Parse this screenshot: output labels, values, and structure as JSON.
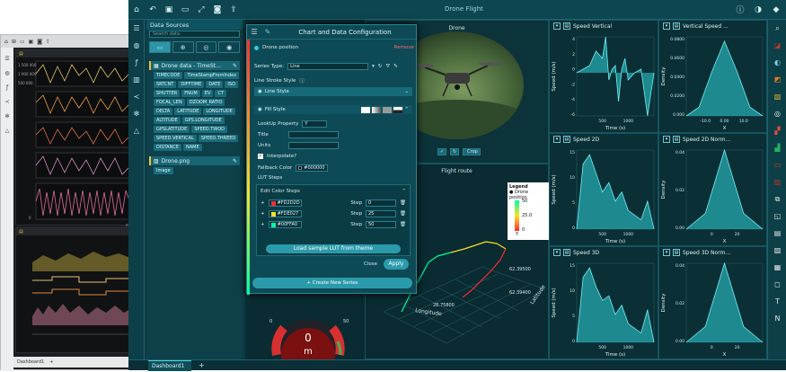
{
  "background_window": {
    "menu_items": [
      "⌂",
      "☰",
      "☁",
      "✂",
      "⚙",
      "⭐"
    ],
    "tab": "Dashboard1",
    "plus": "+",
    "label_m": "m",
    "ticks": [
      "1 500 000",
      "1 000 000",
      "500 000",
      "0"
    ]
  },
  "app": {
    "title": "Drone Flight",
    "status_tab": "Dashboard1",
    "status_plus": "+"
  },
  "data_sources": {
    "title": "Data Sources",
    "search_placeholder": "Search data",
    "source1": "Drone data - TimeSt...",
    "chips": [
      "TIMECODE",
      "TimeStampFromIndex",
      "SRTCNT",
      "DIFFTIME",
      "DATE",
      "ISO",
      "SHUTTER",
      "FNUM",
      "EV",
      "CT",
      "FOCAL_LEN",
      "DZOOM_RATIO",
      "DELTA",
      "LATITUDE",
      "LONGITUDE",
      "ALTITUDE",
      "GPS.LONGITUDE",
      "GPSLATITUDE",
      "SPEED.TWOD",
      "SPEED.VERTICAL",
      "SPEED.THREED",
      "DISTANCE",
      "NAME"
    ],
    "source2": "Drone.png",
    "chips2": [
      "Image"
    ]
  },
  "modal": {
    "title": "Chart and Data Configuration",
    "series_name": "Drone position",
    "remove": "Remove",
    "series_type_label": "Series Type:",
    "series_type_value": "Line",
    "line_stroke_label": "Line Stroke Style",
    "line_style": "Line Style",
    "fill_style": "Fill Style",
    "lookup_label": "LookUp Property",
    "lookup_value": "Y",
    "title_label": "Title",
    "units_label": "Units",
    "interpolate_label": "Interpolate?",
    "fallback_label": "Fallback Color",
    "fallback_value": "#000000",
    "lut_steps": "LUT Steps",
    "edit_color_steps": "Edit Color Steps",
    "steps": [
      {
        "color": "#FD2D2D",
        "label": "#FD2D2D",
        "step_label": "Step",
        "value": "0"
      },
      {
        "color": "#FDE027",
        "label": "#FDE027",
        "step_label": "Step",
        "value": "25"
      },
      {
        "color": "#00FFA0",
        "label": "#00FFA0",
        "step_label": "Step",
        "value": "50"
      }
    ],
    "load_lut": "Load sample LUT from theme",
    "close": "Close",
    "apply": "Apply",
    "create_series": "+ Create New Series"
  },
  "video": {
    "title": "Drone",
    "crop": "Crop"
  },
  "flight": {
    "title": "Flight route",
    "legend_title": "Legend",
    "legend_item": "Drone position",
    "legend_ticks": [
      "50",
      "25.0",
      "0"
    ],
    "legend_axis": "Y",
    "axis_longitude": "Longitude",
    "axis_latitude": "Latitude",
    "tick_lon": "28.75800",
    "tick_lat1": "62.39500",
    "tick_lat2": "62.39400"
  },
  "gauge": {
    "value": "0",
    "unit": "m",
    "min": "0",
    "max": "50"
  },
  "panels": [
    {
      "title": "Speed Vertical",
      "ylabel": "Speed (m/s)",
      "xlabel": "Time (s)",
      "yticks": [
        "4",
        "2",
        "0",
        "-2",
        "-4",
        "-6"
      ],
      "xticks": [
        "500",
        "1000"
      ]
    },
    {
      "title": "Vertical Speed ...",
      "ylabel": "Density",
      "xlabel": "X",
      "yticks": [
        "0.0800",
        "0.0600",
        "0.0400",
        "0.0200",
        "0.000"
      ],
      "xticks": [
        "-10.0",
        "0.00",
        "10.0"
      ]
    },
    {
      "title": "Speed 2D",
      "ylabel": "Speed (m/s)",
      "xlabel": "Time (s)",
      "yticks": [
        "15",
        "10",
        "5",
        "0"
      ],
      "xticks": [
        "500",
        "1000"
      ]
    },
    {
      "title": "Speed 2D Norm...",
      "ylabel": "Density",
      "xlabel": "X",
      "yticks": [
        "0.04",
        "0.02",
        "0.00"
      ],
      "xticks": [
        "0",
        "20"
      ]
    },
    {
      "title": "Speed 3D",
      "ylabel": "Speed (m/s)",
      "xlabel": "Time (s)",
      "yticks": [
        "15",
        "10",
        "5",
        "0"
      ],
      "xticks": [
        "500",
        "1000"
      ]
    },
    {
      "title": "Speed 3D Norm...",
      "ylabel": "Density",
      "xlabel": "X",
      "yticks": [
        "0.04",
        "0.02",
        "0.00"
      ],
      "xticks": [
        "0",
        "20"
      ]
    }
  ],
  "icons": {
    "rail_colors": [
      "#e0e0e0",
      "#c0392b",
      "#7bd4e0",
      "#e67e22",
      "#e0b030",
      "#ecf0f1",
      "#e74c3c",
      "#27ae60",
      "#d35400",
      "#c0392b",
      "#e6e6e6",
      "#e6e6e6",
      "#e6e6e6",
      "#e6e6e6",
      "#e6e6e6",
      "#e6e6e6",
      "#e6e6e6",
      "#e6e6e6"
    ]
  },
  "chart_data": [
    {
      "type": "area",
      "title": "Speed Vertical",
      "xlabel": "Time (s)",
      "ylabel": "Speed (m/s)",
      "x": [
        0,
        100,
        200,
        300,
        400,
        450,
        500,
        550,
        600,
        650,
        700,
        750,
        800,
        900,
        1000,
        1100,
        1200
      ],
      "y": [
        0,
        0.5,
        1,
        3,
        2,
        5,
        -1,
        0.5,
        1,
        -4,
        0.5,
        2,
        -1,
        0,
        0.5,
        -6,
        0
      ],
      "ylim": [
        -6,
        5
      ]
    },
    {
      "type": "area",
      "title": "Vertical Speed ...",
      "xlabel": "X",
      "ylabel": "Density",
      "x": [
        -15,
        -10,
        -5,
        0,
        5,
        10,
        15
      ],
      "y": [
        0,
        0.01,
        0.05,
        0.085,
        0.05,
        0.01,
        0
      ],
      "ylim": [
        0,
        0.09
      ]
    },
    {
      "type": "area",
      "title": "Speed 2D",
      "xlabel": "Time (s)",
      "ylabel": "Speed (m/s)",
      "x": [
        0,
        100,
        200,
        300,
        400,
        500,
        600,
        700,
        800,
        900,
        1000,
        1100,
        1200
      ],
      "y": [
        0,
        14,
        16,
        12,
        8,
        10,
        6,
        8,
        4,
        3,
        2,
        6,
        0
      ],
      "ylim": [
        0,
        17
      ]
    },
    {
      "type": "area",
      "title": "Speed 2D Norm...",
      "xlabel": "X",
      "ylabel": "Density",
      "x": [
        -10,
        0,
        5,
        10,
        15,
        20,
        30
      ],
      "y": [
        0,
        0.01,
        0.03,
        0.05,
        0.03,
        0.01,
        0
      ],
      "ylim": [
        0,
        0.05
      ]
    },
    {
      "type": "area",
      "title": "Speed 3D",
      "xlabel": "Time (s)",
      "ylabel": "Speed (m/s)",
      "x": [
        0,
        100,
        200,
        300,
        400,
        500,
        600,
        700,
        800,
        900,
        1000,
        1100,
        1200
      ],
      "y": [
        0,
        14,
        16,
        12,
        9,
        10,
        6,
        8,
        4,
        3,
        2,
        7,
        0
      ],
      "ylim": [
        0,
        17
      ]
    },
    {
      "type": "area",
      "title": "Speed 3D Norm...",
      "xlabel": "X",
      "ylabel": "Density",
      "x": [
        -10,
        0,
        5,
        10,
        15,
        20,
        30
      ],
      "y": [
        0,
        0.01,
        0.03,
        0.05,
        0.03,
        0.01,
        0
      ],
      "ylim": [
        0,
        0.05
      ]
    }
  ]
}
